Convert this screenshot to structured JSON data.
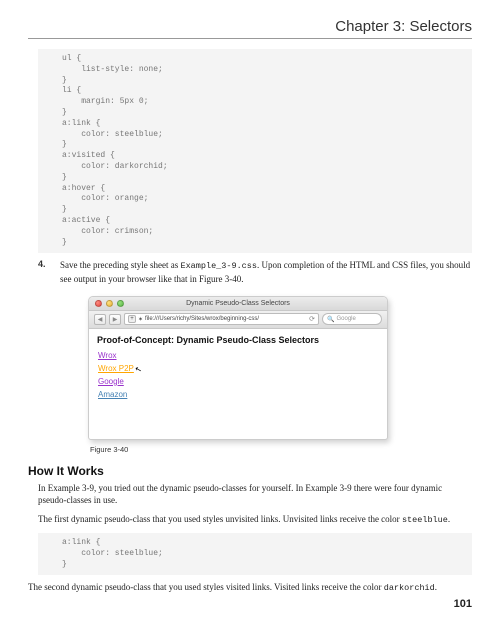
{
  "header": {
    "chapter_title": "Chapter 3: Selectors"
  },
  "code1": "ul {\n    list-style: none;\n}\nli {\n    margin: 5px 0;\n}\na:link {\n    color: steelblue;\n}\na:visited {\n    color: darkorchid;\n}\na:hover {\n    color: orange;\n}\na:active {\n    color: crimson;\n}",
  "step4": {
    "num": "4.",
    "text_a": "Save the preceding style sheet as ",
    "code": "Example_3-9.css",
    "text_b": ". Upon completion of the HTML and CSS files, you should see output in your browser like that in Figure 3-40."
  },
  "browser": {
    "title": "Dynamic Pseudo-Class Selectors",
    "nav": {
      "back": "◀",
      "fwd": "▶"
    },
    "addr_plus": "+",
    "addr_icon": "✶",
    "address": "file:///Users/richy/Sites/wrox/beginning-css/",
    "reload_icon": "⟳",
    "search_icon": "🔍",
    "search_placeholder": "Google",
    "page_heading": "Proof-of-Concept: Dynamic Pseudo-Class Selectors",
    "links": [
      {
        "label": "Wrox",
        "state": "visited"
      },
      {
        "label": "Wrox P2P",
        "state": "hover"
      },
      {
        "label": "Google",
        "state": "visited"
      },
      {
        "label": "Amazon",
        "state": "link"
      }
    ],
    "cursor": "↖"
  },
  "figure_caption": "Figure 3-40",
  "how_it_works": {
    "heading": "How It Works",
    "para1": "In Example 3-9, you tried out the dynamic pseudo-classes for yourself. In Example 3-9 there were four dynamic pseudo-classes in use.",
    "para2_a": "The first dynamic pseudo-class that you used styles unvisited links. Unvisited links receive the color ",
    "para2_code": "steelblue",
    "para2_b": ".",
    "code2": "a:link {\n    color: steelblue;\n}",
    "para3_a": "The second dynamic pseudo-class that you used styles visited links. Visited links receive the color ",
    "para3_code": "darkorchid",
    "para3_b": "."
  },
  "page_number": "101"
}
